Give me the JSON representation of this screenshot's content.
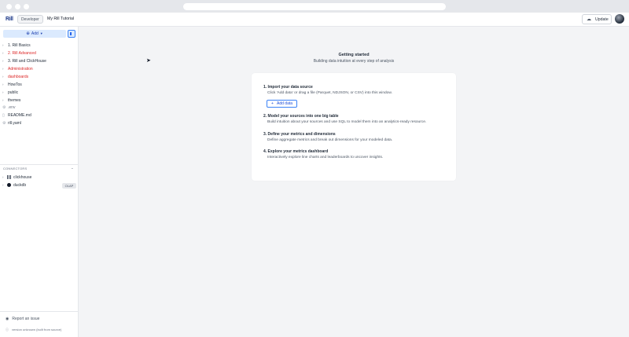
{
  "header": {
    "logo": "Rill",
    "environment": "Developer",
    "project": "My Rill Tutorial",
    "update_label": "Update",
    "update_icon": "cloud-upload-icon"
  },
  "sidebar": {
    "add_label": "Add",
    "files": [
      {
        "label": "1. Rill Basics",
        "type": "folder"
      },
      {
        "label": "2. Rill Advanced",
        "type": "folder",
        "error": true
      },
      {
        "label": "3. Rill and ClickHouse",
        "type": "folder"
      },
      {
        "label": "Administration",
        "type": "folder",
        "error": true
      },
      {
        "label": "dashboards",
        "type": "folder",
        "error": true
      },
      {
        "label": "HowTos",
        "type": "folder"
      },
      {
        "label": "public",
        "type": "folder"
      },
      {
        "label": "themes",
        "type": "folder"
      },
      {
        "label": ".env",
        "type": "file-config"
      },
      {
        "label": "README.md",
        "type": "file-doc"
      },
      {
        "label": "rill.yaml",
        "type": "file-config"
      }
    ],
    "connectors_header": "CONNECTORS",
    "connectors": [
      {
        "label": "clickhouse",
        "icon": "clickhouse-icon"
      },
      {
        "label": "duckdb",
        "icon": "duckdb-icon",
        "badge": "OLAP"
      }
    ],
    "report_issue": "Report an issue",
    "version": "version unknown (built from source)"
  },
  "main": {
    "title": "Getting started",
    "subtitle": "Building data intuition at every step of analysis",
    "steps": [
      {
        "title": "1. Import your data source",
        "desc": "Click 'Add data' or drag a file (Parquet, NDJSON, or CSV) into this window."
      },
      {
        "title": "2. Model your sources into one big table",
        "desc": "Build intuition about your sources and use SQL to model them into an analytics-ready resource."
      },
      {
        "title": "3. Define your metrics and dimensions",
        "desc": "Define aggregate metrics and break out dimensions for your modeled data."
      },
      {
        "title": "4. Explore your metrics dashboard",
        "desc": "Interactively explore line charts and leaderboards to uncover insights."
      }
    ],
    "add_data_label": "Add data"
  },
  "colors": {
    "accent": "#2563eb",
    "error_text": "#dc2626",
    "background": "#f3f4f6"
  }
}
